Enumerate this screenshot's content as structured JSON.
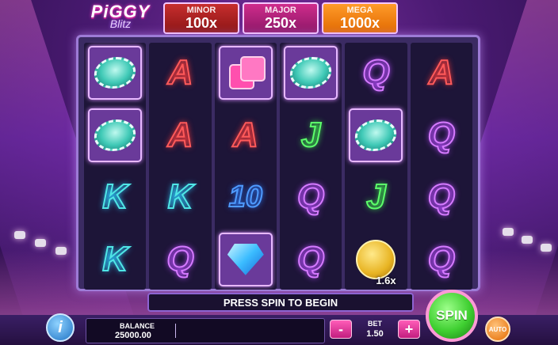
{
  "logo": {
    "line1": "PiGGY",
    "line2": "Blitz"
  },
  "jackpots": [
    {
      "name": "MINOR",
      "value": "100x",
      "color": "#b11f1f"
    },
    {
      "name": "MAJOR",
      "value": "250x",
      "color": "#b1227a"
    },
    {
      "name": "MEGA",
      "value": "1000x",
      "color": "#f58a12"
    }
  ],
  "reels": [
    [
      {
        "type": "chip-icon"
      },
      {
        "type": "chip-icon"
      },
      {
        "type": "letter",
        "text": "K"
      },
      {
        "type": "letter",
        "text": "K"
      }
    ],
    [
      {
        "type": "letter",
        "text": "A"
      },
      {
        "type": "letter",
        "text": "A"
      },
      {
        "type": "letter",
        "text": "K"
      },
      {
        "type": "letter",
        "text": "Q"
      }
    ],
    [
      {
        "type": "dice-icon"
      },
      {
        "type": "letter",
        "text": "A"
      },
      {
        "type": "letter",
        "text": "10"
      },
      {
        "type": "diamond-icon"
      }
    ],
    [
      {
        "type": "chip-icon"
      },
      {
        "type": "letter",
        "text": "J"
      },
      {
        "type": "letter",
        "text": "Q"
      },
      {
        "type": "letter",
        "text": "Q"
      }
    ],
    [
      {
        "type": "letter",
        "text": "Q"
      },
      {
        "type": "chip-icon"
      },
      {
        "type": "letter",
        "text": "J"
      },
      {
        "type": "coin-icon",
        "label": "1.6x"
      }
    ],
    [
      {
        "type": "letter",
        "text": "A"
      },
      {
        "type": "letter",
        "text": "Q"
      },
      {
        "type": "letter",
        "text": "Q"
      },
      {
        "type": "letter",
        "text": "Q"
      }
    ]
  ],
  "message": "PRESS SPIN TO BEGIN",
  "info_label": "i",
  "balance": {
    "label": "BALANCE",
    "value": "25000.00"
  },
  "bet": {
    "label": "BET",
    "value": "1.50",
    "minus": "-",
    "plus": "+"
  },
  "spin_label": "SPIN",
  "auto_label": "AUTO"
}
